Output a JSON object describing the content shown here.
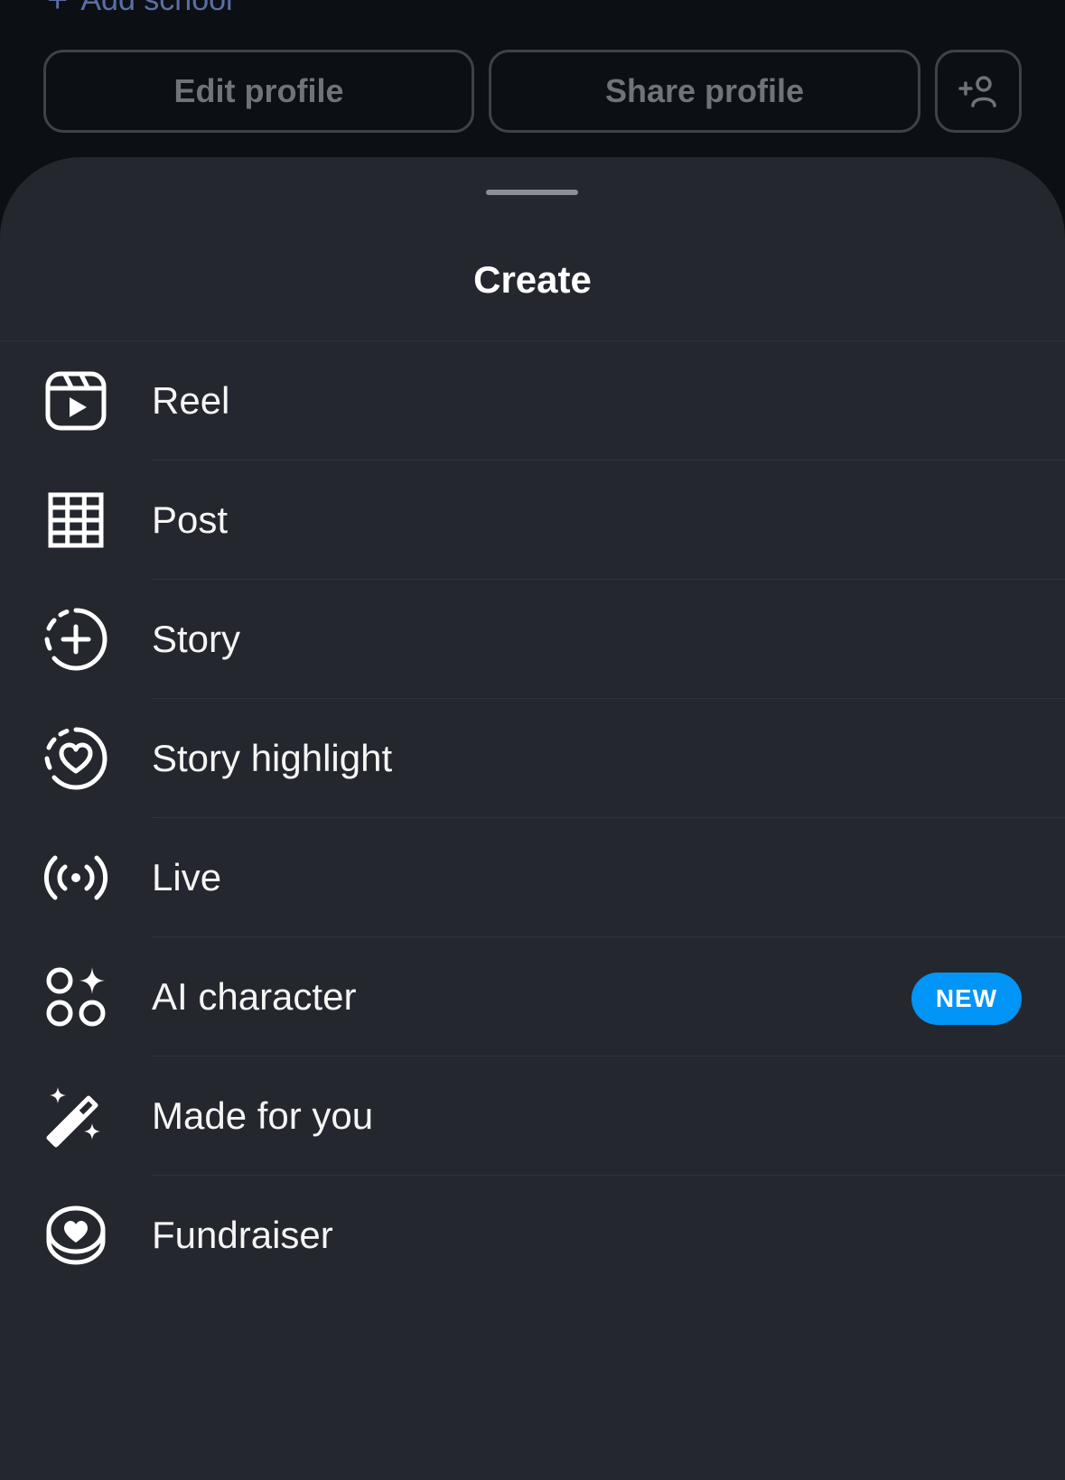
{
  "profile": {
    "add_school_label": "Add school",
    "edit_label": "Edit profile",
    "share_label": "Share profile",
    "add_user_icon": "add-user-icon"
  },
  "sheet": {
    "title": "Create",
    "items": [
      {
        "label": "Reel",
        "icon": "reel-icon"
      },
      {
        "label": "Post",
        "icon": "grid-icon"
      },
      {
        "label": "Story",
        "icon": "story-plus-icon"
      },
      {
        "label": "Story highlight",
        "icon": "highlight-heart-icon"
      },
      {
        "label": "Live",
        "icon": "live-broadcast-icon"
      },
      {
        "label": "AI character",
        "icon": "ai-sparkle-icon",
        "badge": "NEW"
      },
      {
        "label": "Made for you",
        "icon": "magic-wand-icon"
      },
      {
        "label": "Fundraiser",
        "icon": "fundraiser-coin-icon"
      }
    ]
  },
  "colors": {
    "background": "#0c1014",
    "sheet": "#24272e",
    "badge": "#0095f6"
  }
}
